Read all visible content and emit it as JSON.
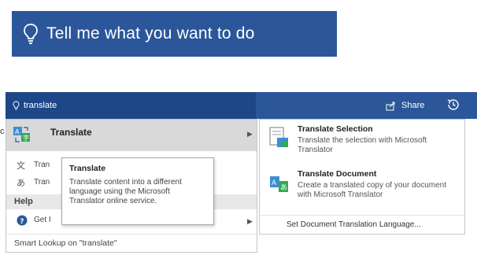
{
  "banner": {
    "text": "Tell me what you want to do"
  },
  "ribbon": {
    "search_value": "translate",
    "share_label": "Share"
  },
  "menu": {
    "main_item": "Translate",
    "rows": [
      "Tran",
      "Tran"
    ],
    "help_header": "Help",
    "get_row": "Get I",
    "smart_lookup": "Smart Lookup on \"translate\""
  },
  "tooltip": {
    "title": "Translate",
    "body": "Translate content into a different language using the Microsoft Translator online service."
  },
  "submenu": {
    "selection": {
      "title": "Translate Selection",
      "desc": "Translate the selection with Microsoft Translator"
    },
    "document": {
      "title": "Translate Document",
      "desc": "Create a translated copy of your document with Microsoft Translator"
    },
    "footer": "Set Document Translation Language..."
  },
  "colors": {
    "ribbon": "#2b579a",
    "ribbon_dark": "#1e4788",
    "hover": "#d9d9d9"
  },
  "icons": [
    "lightbulb-icon",
    "share-icon",
    "history-icon",
    "translate-icon",
    "help-icon",
    "translate-selection-icon",
    "translate-document-icon"
  ]
}
